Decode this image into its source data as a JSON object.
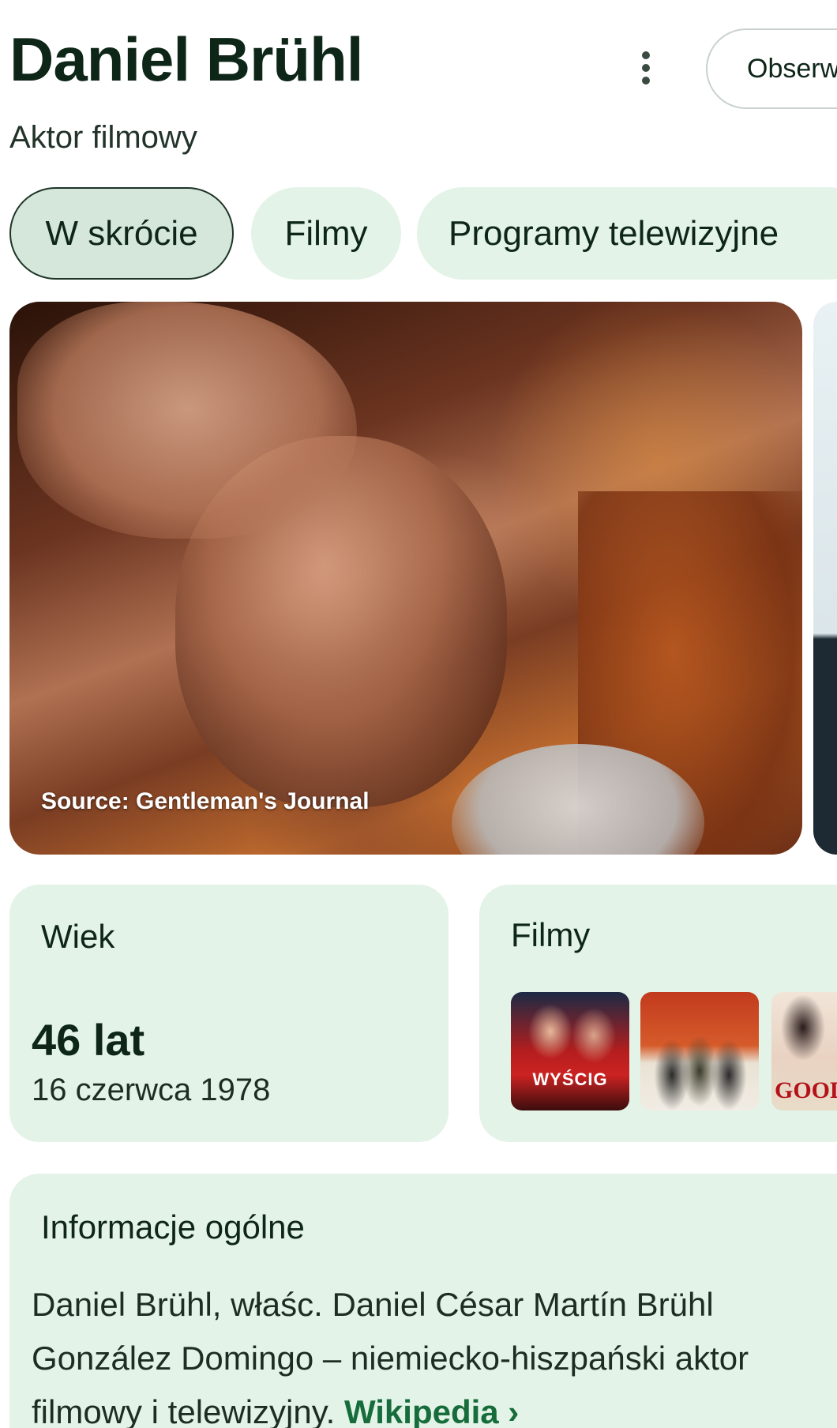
{
  "header": {
    "title": "Daniel Brühl",
    "subtitle": "Aktor filmowy",
    "follow_label": "Obserwuj"
  },
  "tabs": [
    {
      "label": "W skrócie",
      "active": true
    },
    {
      "label": "Filmy",
      "active": false
    },
    {
      "label": "Programy telewizyjne",
      "active": false
    }
  ],
  "hero": {
    "caption": "Source: Gentleman's Journal"
  },
  "age_card": {
    "label": "Wiek",
    "value": "46 lat",
    "date": "16 czerwca 1978"
  },
  "films_card": {
    "label": "Filmy",
    "posters": [
      {
        "text": "WYŚCIG"
      },
      {
        "text": ""
      },
      {
        "text": "GOOD"
      }
    ]
  },
  "info_card": {
    "label": "Informacje ogólne",
    "text": "Daniel Brühl, właśc. Daniel César Martín Brühl González Domingo – niemiecko-hiszpański aktor filmowy i telewizyjny. ",
    "link": "Wikipedia ›"
  },
  "colors": {
    "chip_bg": "#e3f3e7",
    "card_bg": "#e3f3e7",
    "link": "#166c3a",
    "text": "#0d2617"
  }
}
